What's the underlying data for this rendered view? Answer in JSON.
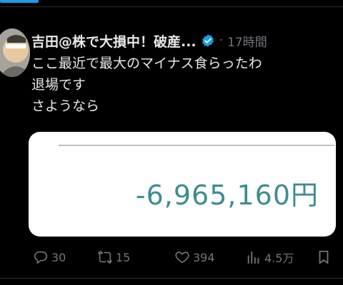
{
  "post": {
    "author_name": "吉田@株で大損中！破産...",
    "separator": "·",
    "time": "17時間",
    "text_lines": [
      "ここ最近で最大のマイナス食らったわ",
      "退場です",
      "さようなら"
    ],
    "media": {
      "amount_text": "-6,965,160円"
    }
  },
  "actions": {
    "replies": "30",
    "reposts": "15",
    "likes": "394",
    "views": "4.5万"
  },
  "icons": {
    "verified": "verified-badge-icon",
    "reply": "reply-icon",
    "repost": "repost-icon",
    "like": "heart-icon",
    "views": "views-chart-icon",
    "bookmark": "bookmark-icon"
  },
  "colors": {
    "accent": "#1d9bf0",
    "amount": "#3f8c8f",
    "muted": "#71767b"
  }
}
